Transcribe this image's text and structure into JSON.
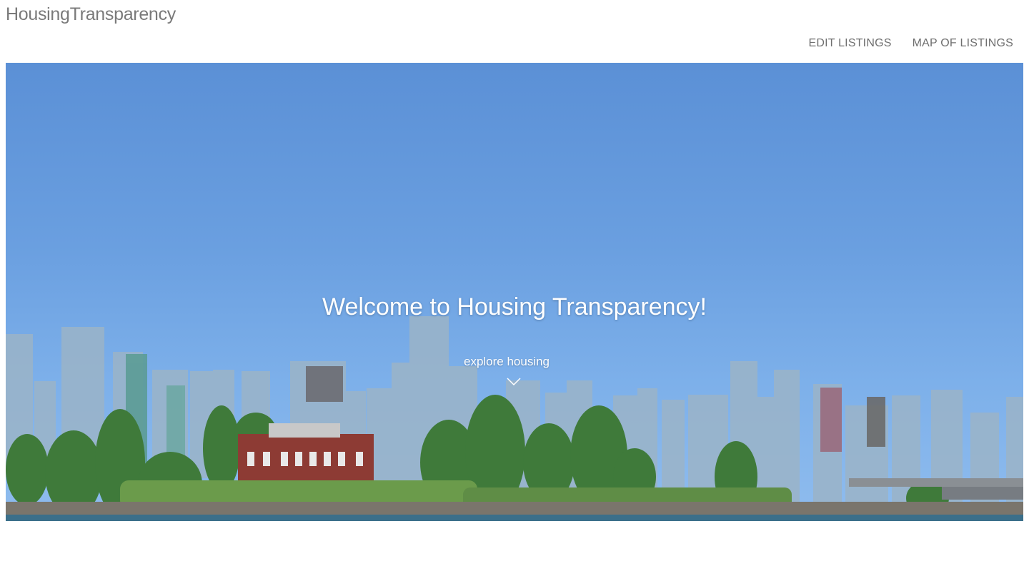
{
  "header": {
    "brand": "HousingTransparency",
    "nav": [
      {
        "label": "EDIT LISTINGS"
      },
      {
        "label": "MAP OF LISTINGS"
      }
    ]
  },
  "hero": {
    "title": "Welcome to Housing Transparency!",
    "explore_label": "explore housing",
    "explore_icon": "chevron-down-icon",
    "image": "city-skyline-waterfront-photo"
  },
  "colors": {
    "brand_text": "#7a7a7a",
    "nav_text": "#6f6f6f",
    "sky": "#6a9fe0",
    "hero_text": "#ffffff"
  }
}
